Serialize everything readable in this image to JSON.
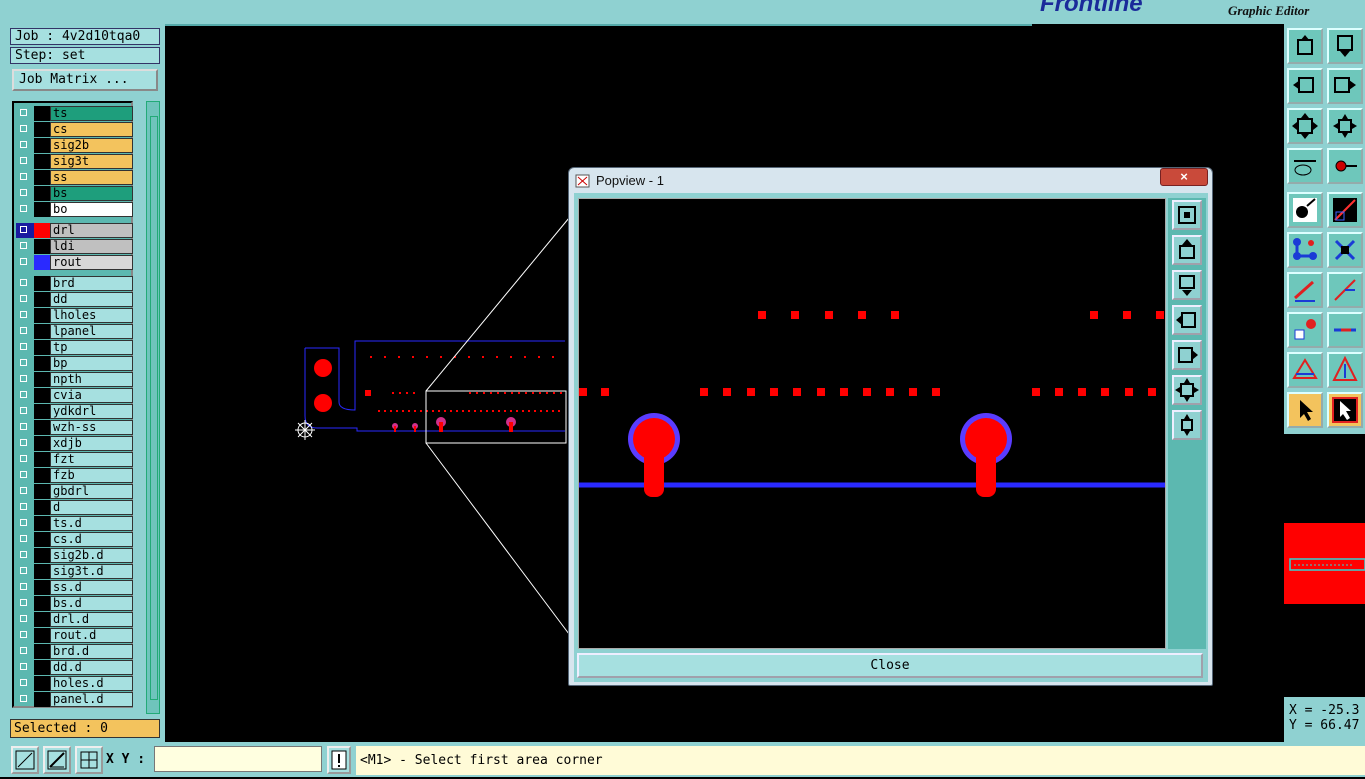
{
  "app": {
    "brand": "Frontline",
    "subtitle": "Graphic Editor"
  },
  "job": {
    "job_label": "Job : 4v2d10tqa0",
    "step_label": "Step: set",
    "matrix_button": "Job Matrix ..."
  },
  "layers": [
    {
      "name": "ts",
      "color": "#1e9e7c"
    },
    {
      "name": "cs",
      "color": "#f3c35d"
    },
    {
      "name": "sig2b",
      "color": "#f3c35d"
    },
    {
      "name": "sig3t",
      "color": "#f3c35d"
    },
    {
      "name": "ss",
      "color": "#f3c35d"
    },
    {
      "name": "bs",
      "color": "#1e9e7c"
    },
    {
      "name": "bo",
      "color": "#ffffff"
    },
    {
      "name": "drl",
      "color": "#c0c0c0",
      "swatch": "#ff0000",
      "active": true
    },
    {
      "name": "ldi",
      "color": "#c0c0c0"
    },
    {
      "name": "rout",
      "color": "#d8d8d8",
      "swatch": "#2a2aff"
    },
    {
      "name": "brd",
      "color": "#a6e0e0"
    },
    {
      "name": "dd",
      "color": "#a6e0e0"
    },
    {
      "name": "lholes",
      "color": "#a6e0e0"
    },
    {
      "name": "lpanel",
      "color": "#a6e0e0"
    },
    {
      "name": "tp",
      "color": "#a6e0e0"
    },
    {
      "name": "bp",
      "color": "#a6e0e0"
    },
    {
      "name": "npth",
      "color": "#a6e0e0"
    },
    {
      "name": "cvia",
      "color": "#a6e0e0"
    },
    {
      "name": "ydkdrl",
      "color": "#a6e0e0"
    },
    {
      "name": "wzh-ss",
      "color": "#a6e0e0"
    },
    {
      "name": "xdjb",
      "color": "#a6e0e0"
    },
    {
      "name": "fzt",
      "color": "#a6e0e0"
    },
    {
      "name": "fzb",
      "color": "#a6e0e0"
    },
    {
      "name": "gbdrl",
      "color": "#a6e0e0"
    },
    {
      "name": "d",
      "color": "#a6e0e0"
    },
    {
      "name": "ts.d",
      "color": "#a6e0e0"
    },
    {
      "name": "cs.d",
      "color": "#a6e0e0"
    },
    {
      "name": "sig2b.d",
      "color": "#a6e0e0"
    },
    {
      "name": "sig3t.d",
      "color": "#a6e0e0"
    },
    {
      "name": "ss.d",
      "color": "#a6e0e0"
    },
    {
      "name": "bs.d",
      "color": "#a6e0e0"
    },
    {
      "name": "drl.d",
      "color": "#a6e0e0"
    },
    {
      "name": "rout.d",
      "color": "#a6e0e0"
    },
    {
      "name": "brd.d",
      "color": "#a6e0e0"
    },
    {
      "name": "dd.d",
      "color": "#a6e0e0"
    },
    {
      "name": "holes.d",
      "color": "#a6e0e0"
    },
    {
      "name": "panel.d",
      "color": "#a6e0e0"
    }
  ],
  "selected_label": "Selected : 0",
  "input": {
    "xy_label": "X Y :",
    "xy_value": ""
  },
  "status": {
    "message": "<M1> - Select first area corner"
  },
  "coords": {
    "x_label": "X = -25.3",
    "y_label": "Y = 66.47"
  },
  "popview": {
    "title": "Popview - 1",
    "close_label": "Close",
    "close_x": "×"
  },
  "colors": {
    "panel": "#8fd1d1",
    "drill": "#ff0000",
    "rout": "#2a2aff"
  }
}
